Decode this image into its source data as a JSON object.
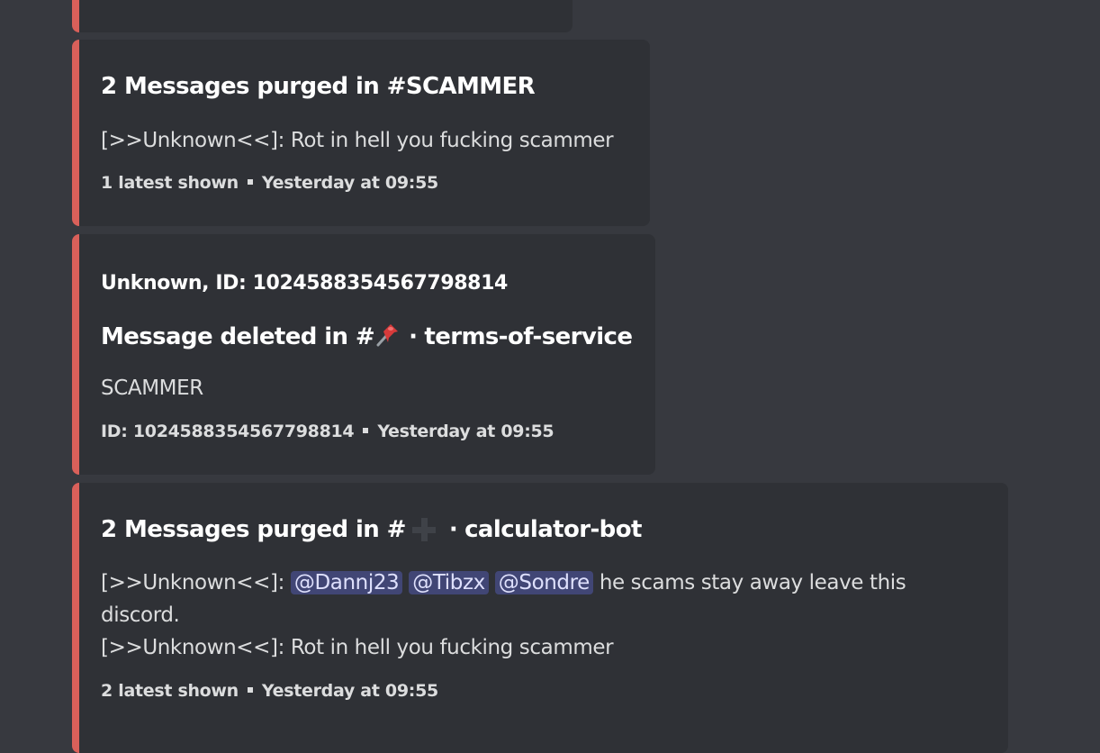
{
  "embeds": [
    {
      "title": "",
      "description": "",
      "footer": {
        "left": "",
        "right": ""
      }
    },
    {
      "title": "2 Messages purged in #SCAMMER",
      "description_lines": [
        "[>>Unknown<<]: Rot in hell you fucking scammer"
      ],
      "footer": {
        "left": "1 latest shown",
        "right": "Yesterday at 09:55"
      }
    },
    {
      "author": "Unknown, ID: 1024588354567798814",
      "title_prefix": "Message deleted in #",
      "title_icon": "pushpin-icon",
      "title_suffix": "terms-of-service",
      "description": "SCAMMER",
      "footer": {
        "left": "ID: 1024588354567798814",
        "right": "Yesterday at 09:55"
      }
    },
    {
      "title_prefix": "2 Messages purged in #",
      "title_icon": "plus-icon",
      "title_suffix": "calculator-bot",
      "line1_prefix": "[>>Unknown<<]:",
      "mentions": [
        "@Dannj23",
        "@Tibzx",
        "@Sondre"
      ],
      "line1_suffix": "he scams stay away leave this",
      "line2": "discord.",
      "line3": "[>>Unknown<<]: Rot in hell you fucking scammer",
      "footer": {
        "left": "2 latest shown",
        "right": "Yesterday at 09:55"
      }
    }
  ],
  "colors": {
    "background": "#37393f",
    "embed_bg": "#2f3136",
    "accent": "#d9605a",
    "mention_bg": "#414675",
    "mention_text": "#dee0fc"
  }
}
